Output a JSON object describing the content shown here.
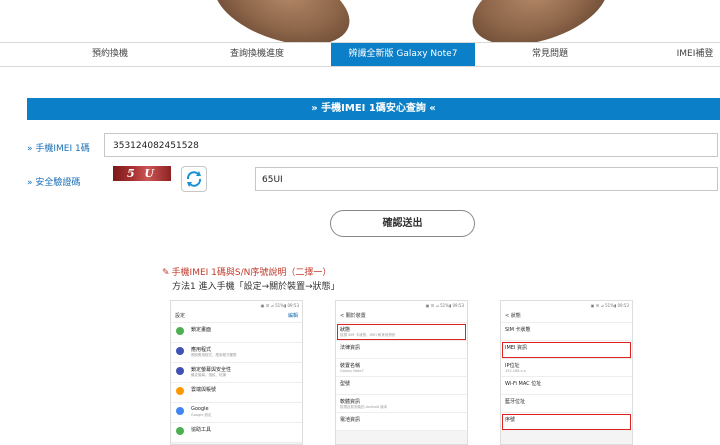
{
  "tabs": [
    {
      "label": "預約換機",
      "active": false
    },
    {
      "label": "查詢換機進度",
      "active": false
    },
    {
      "label": "辨識全新版 Galaxy Note7",
      "active": true
    },
    {
      "label": "常見問題",
      "active": false
    },
    {
      "label": "IMEI補登",
      "active": false
    }
  ],
  "banner_title": "» 手機IMEI 1碼安心查詢 «",
  "form": {
    "imei_label": "» 手機IMEI 1碼",
    "imei_value": "353124082451528",
    "captcha_label": "» 安全驗證碼",
    "captcha_text": "5 U",
    "code_value": "65UI",
    "submit_label": "確認送出"
  },
  "help": {
    "title": "手機IMEI 1碼與S/N序號說明（二擇一）",
    "desc": "方法1 進入手機「設定→關於裝置→狀態」"
  },
  "phones": [
    {
      "status": "▣ ☰ ⊿ 51%▮ 09:53",
      "header": "設定",
      "action": "編輯",
      "rows": [
        {
          "title": "鎖定畫面",
          "sub": "",
          "icon_color": "#4caf50"
        },
        {
          "title": "應用程式",
          "sub": "預設應用程式、應用程式權限",
          "icon_color": "#3f51b5"
        },
        {
          "title": "鎖定螢幕與安全性",
          "sub": "鎖定螢幕、指紋、虹膜",
          "icon_color": "#3f51b5"
        },
        {
          "title": "雲端與帳號",
          "sub": "",
          "icon_color": "#ff9800"
        },
        {
          "title": "Google",
          "sub": "Google 設定",
          "icon_color": "#4285f4"
        },
        {
          "title": "協助工具",
          "sub": "",
          "icon_color": "#4caf50"
        }
      ]
    },
    {
      "status": "▣ ☰ ⊿ 51%▮ 09:53",
      "header": "< 關於裝置",
      "action": "",
      "rows": [
        {
          "title": "狀態",
          "sub": "檢視 SIM 卡狀態、IMEI 和其他資訊",
          "highlight": true
        },
        {
          "title": "法律資訊",
          "sub": ""
        },
        {
          "title": "裝置名稱",
          "sub": "Galaxy Note7"
        },
        {
          "title": "型號",
          "sub": ""
        },
        {
          "title": "軟體資訊",
          "sub": "檢視目前安裝的 Android 版本"
        },
        {
          "title": "電池資訊",
          "sub": ""
        }
      ]
    },
    {
      "status": "▣ ☰ ⊿ 51%▮ 09:53",
      "header": "< 狀態",
      "action": "",
      "rows": [
        {
          "title": "SIM 卡狀態",
          "sub": ""
        },
        {
          "title": "IMEI 資訊",
          "sub": "",
          "highlight": true
        },
        {
          "title": "IP位址",
          "sub": "192.168.x.x"
        },
        {
          "title": "Wi-Fi MAC 位址",
          "sub": ""
        },
        {
          "title": "藍牙位址",
          "sub": ""
        },
        {
          "title": "序號",
          "sub": "",
          "highlight": true
        }
      ]
    }
  ]
}
